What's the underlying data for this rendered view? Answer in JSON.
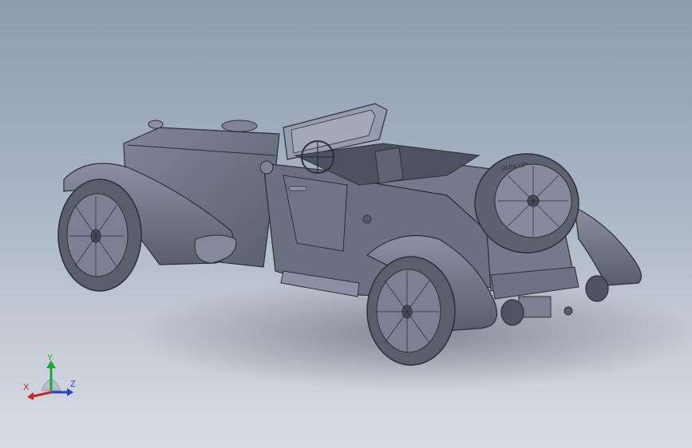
{
  "viewport": {
    "background_top": "#8e9cb0",
    "background_bottom": "#d7dde4",
    "model_shade": "#6e7485",
    "model_edge": "#2b2f3a"
  },
  "model": {
    "tire_brand": "DUNLOP"
  },
  "triad": {
    "x_label": "X",
    "y_label": "Y",
    "z_label": "Z",
    "x_color": "#d42020",
    "y_color": "#1fa83a",
    "z_color": "#2a3fd0"
  }
}
